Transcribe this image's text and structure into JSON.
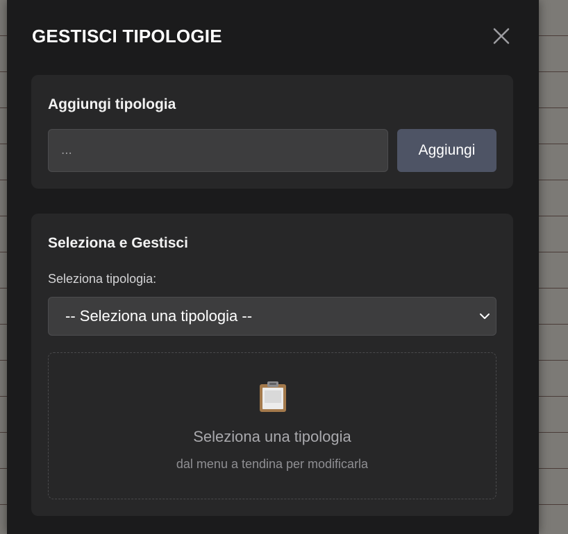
{
  "modal": {
    "title": "GESTISCI TIPOLOGIE",
    "close_icon": "close-icon"
  },
  "add_section": {
    "title": "Aggiungi tipologia",
    "input_placeholder": "...",
    "input_value": "",
    "button_label": "Aggiungi"
  },
  "manage_section": {
    "title": "Seleziona e Gestisci",
    "select_label": "Seleziona tipologia:",
    "select_value": "-- Seleziona una tipologia --",
    "empty_state": {
      "icon": "clipboard-icon",
      "title": "Seleziona una tipologia",
      "subtitle": "dal menu a tendina per modificarla"
    }
  },
  "colors": {
    "modal_bg": "#1b1b1c",
    "card_bg": "#272728",
    "input_bg": "#3d3d3e",
    "button_bg": "#4e5465"
  }
}
